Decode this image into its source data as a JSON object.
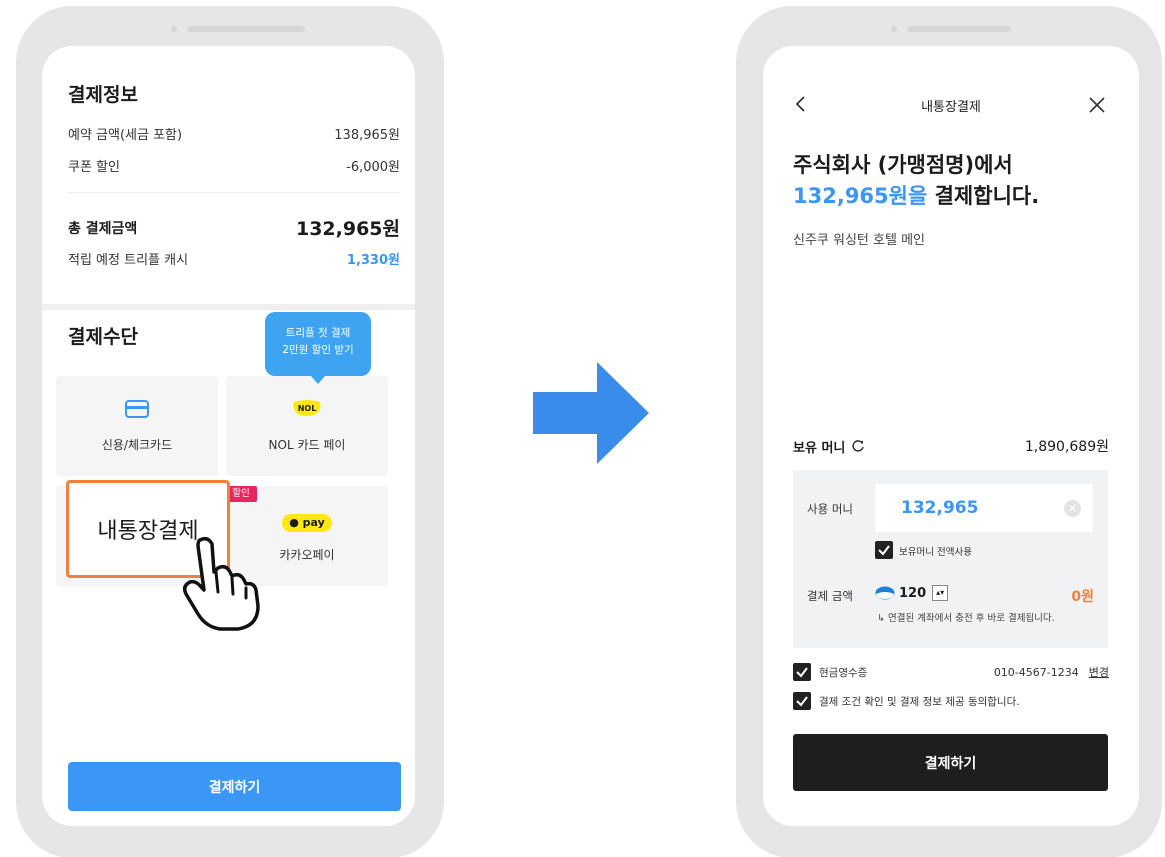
{
  "left": {
    "payment_info": {
      "title": "결제정보",
      "reserve_label": "예약 금액(세금 포함)",
      "reserve_value": "138,965원",
      "coupon_label": "쿠폰 할인",
      "coupon_value": "-6,000원",
      "total_label": "총 결제금액",
      "total_value": "132,965원",
      "points_label": "적립 예정 트리플 캐시",
      "points_value": "1,330원"
    },
    "payment_method": {
      "title": "결제수단",
      "tooltip_line1": "트리플 첫 결제",
      "tooltip_line2": "2만원 할인 받기",
      "credit_card": "신용/체크카드",
      "nol_logo": "NOL",
      "nol_card": "NOL 카드 페이",
      "bank_pay": "내통장결제",
      "discount_badge": "할인",
      "kakao_logo": "pay",
      "kakao_pay": "카카오페이"
    },
    "pay_button": "결제하기"
  },
  "right": {
    "nav_title": "내통장결제",
    "headline_line1": "주식회사 (가맹점명)에서",
    "headline_amount": "132,965원을",
    "headline_rest": " 결제합니다.",
    "merchant": "신주쿠 워싱턴 호텔 메인",
    "held_money_label": "보유 머니",
    "held_money_value": "1,890,689원",
    "use_money_label": "사용 머니",
    "use_money_value": "132,965",
    "use_all_label": "보유머니 전액사용",
    "pay_amount_label": "결제 금액",
    "pay_amount_coin": "120",
    "pay_amount_value": "0원",
    "pay_amount_note": "↳ 연결된 계좌에서 충전 후 바로 결제됩니다.",
    "receipt_label": "현금영수증",
    "receipt_phone": "010-4567-1234",
    "receipt_change": "변경",
    "agree_label": "결제 조건 확인 및 결제 정보 제공 동의합니다.",
    "pay_button": "결제하기"
  },
  "colors": {
    "accent_blue": "#3a97f5",
    "orange": "#f0813c",
    "kakao_yellow": "#ffe812",
    "badge_pink": "#e8265e",
    "dark_button": "#1e1e1e"
  },
  "icons": [
    "card-icon",
    "nol-logo-icon",
    "kakao-pay-icon",
    "hand-cursor-icon",
    "right-arrow-icon",
    "back-icon",
    "close-icon",
    "refresh-icon",
    "clear-icon",
    "coin-icon",
    "stepper-icon",
    "checkbox-icon"
  ]
}
